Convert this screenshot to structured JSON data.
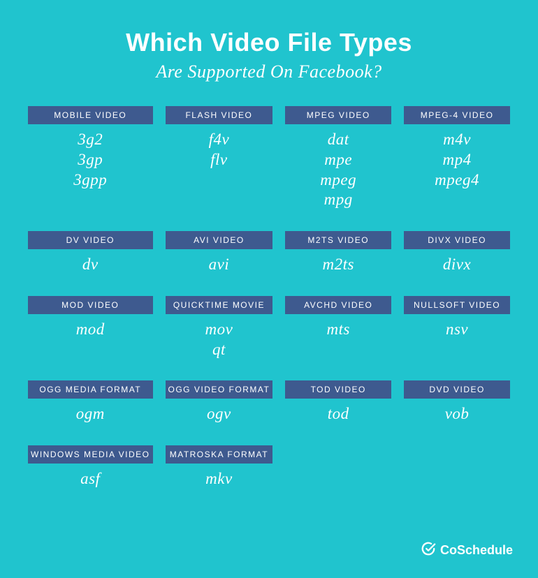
{
  "colors": {
    "background": "#20C4CE",
    "header_bg": "#3E5A8F",
    "text": "#FFFFFF"
  },
  "title": "Which Video File Types",
  "subtitle": "Are Supported On Facebook?",
  "brand": "CoSchedule",
  "categories": [
    {
      "name": "MOBILE VIDEO",
      "extensions": [
        "3g2",
        "3gp",
        "3gpp"
      ]
    },
    {
      "name": "FLASH VIDEO",
      "extensions": [
        "f4v",
        "flv"
      ]
    },
    {
      "name": "MPEG VIDEO",
      "extensions": [
        "dat",
        "mpe",
        "mpeg",
        "mpg"
      ]
    },
    {
      "name": "MPEG-4 VIDEO",
      "extensions": [
        "m4v",
        "mp4",
        "mpeg4"
      ]
    },
    {
      "name": "DV VIDEO",
      "extensions": [
        "dv"
      ]
    },
    {
      "name": "AVI VIDEO",
      "extensions": [
        "avi"
      ]
    },
    {
      "name": "M2TS VIDEO",
      "extensions": [
        "m2ts"
      ]
    },
    {
      "name": "DIVX VIDEO",
      "extensions": [
        "divx"
      ]
    },
    {
      "name": "MOD VIDEO",
      "extensions": [
        "mod"
      ]
    },
    {
      "name": "QUICKTIME MOVIE",
      "extensions": [
        "mov",
        "qt"
      ]
    },
    {
      "name": "AVCHD VIDEO",
      "extensions": [
        "mts"
      ]
    },
    {
      "name": "NULLSOFT VIDEO",
      "extensions": [
        "nsv"
      ]
    },
    {
      "name": "OGG MEDIA FORMAT",
      "extensions": [
        "ogm"
      ]
    },
    {
      "name": "OGG VIDEO FORMAT",
      "extensions": [
        "ogv"
      ]
    },
    {
      "name": "TOD VIDEO",
      "extensions": [
        "tod"
      ]
    },
    {
      "name": "DVD VIDEO",
      "extensions": [
        "vob"
      ]
    },
    {
      "name": "WINDOWS MEDIA VIDEO",
      "extensions": [
        "asf"
      ]
    },
    {
      "name": "MATROSKA FORMAT",
      "extensions": [
        "mkv"
      ]
    }
  ]
}
